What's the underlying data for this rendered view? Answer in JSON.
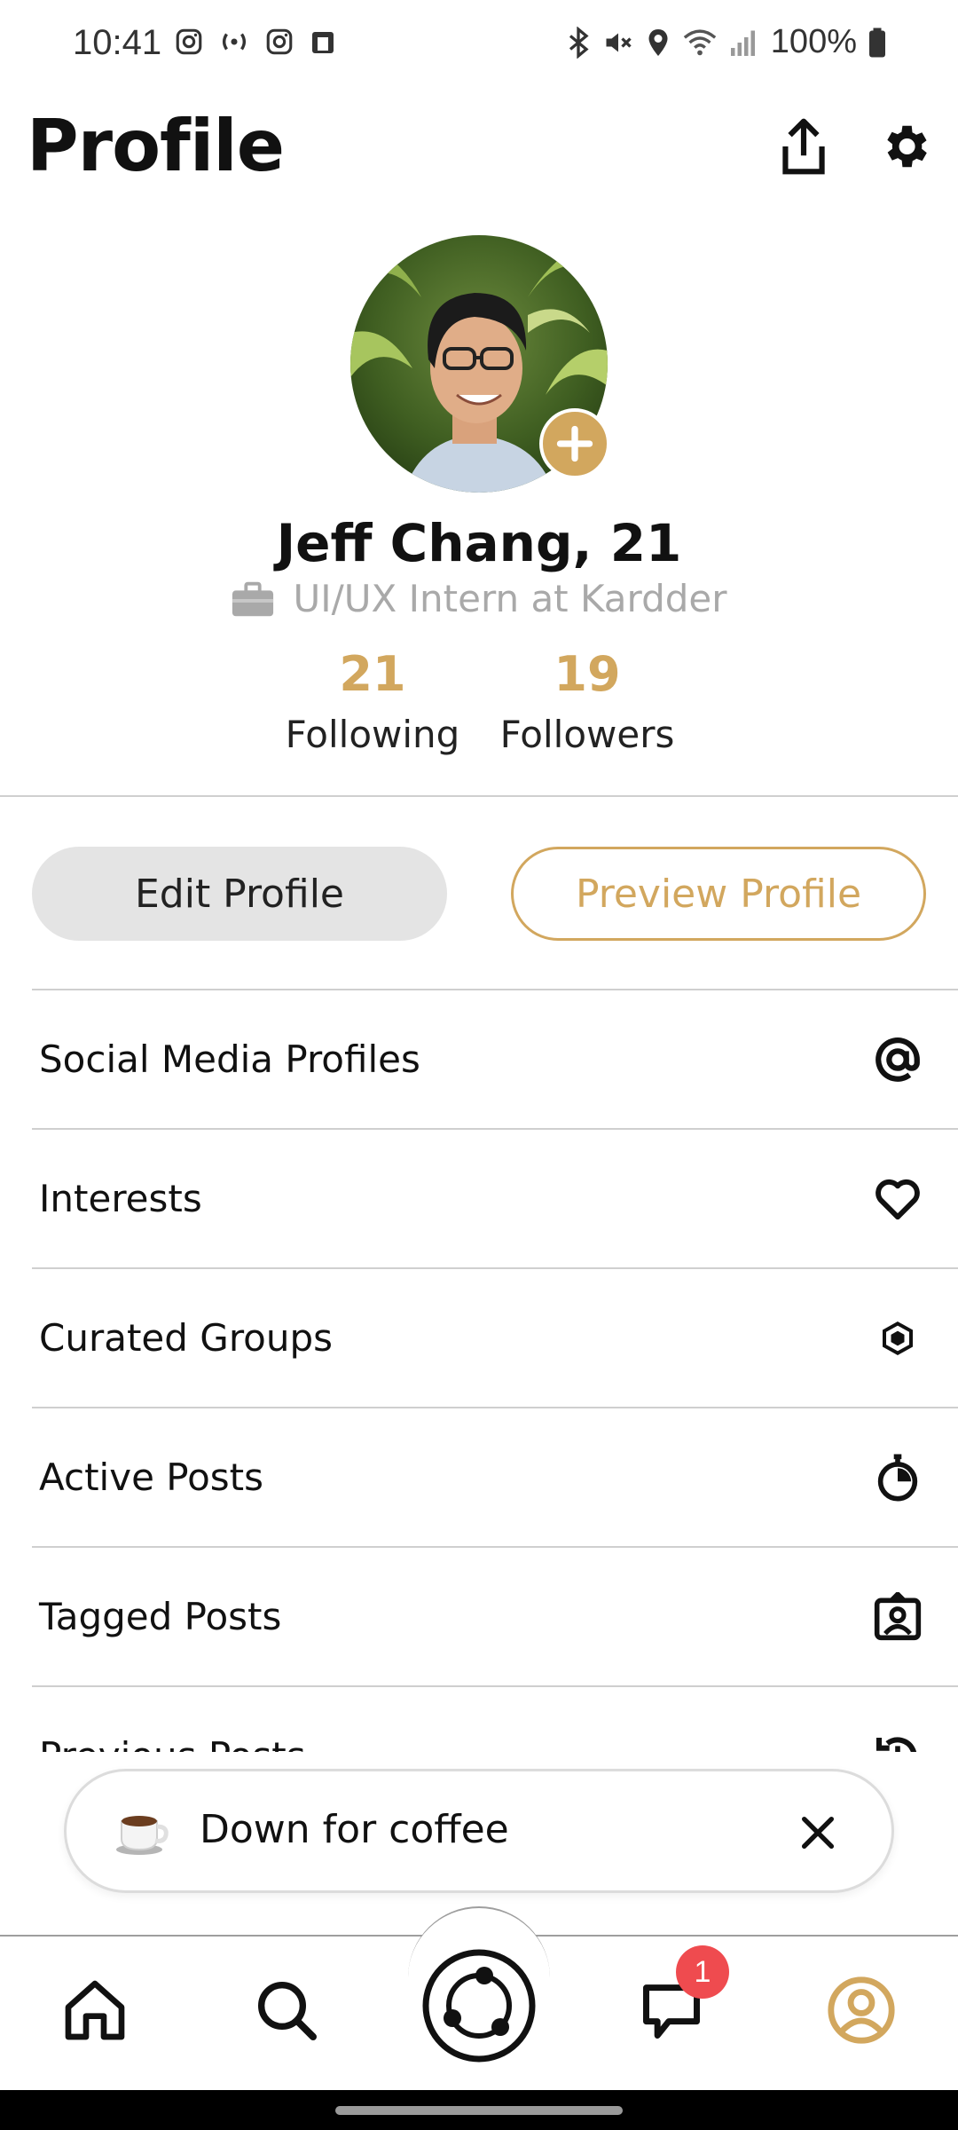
{
  "status_bar": {
    "time": "10:41",
    "battery": "100%",
    "left_icons": [
      "instagram-icon",
      "broadcast-icon",
      "instagram-icon",
      "cast-icon"
    ],
    "right_icons": [
      "bluetooth-icon",
      "mute-icon",
      "location-icon",
      "wifi-icon",
      "signal-icon",
      "battery-icon"
    ]
  },
  "header": {
    "title": "Profile",
    "share_icon": "share-icon",
    "settings_icon": "gear-icon"
  },
  "profile": {
    "name": "Jeff Chang, 21",
    "job": "UI/UX Intern at Kardder",
    "following_count": "21",
    "following_label": "Following",
    "followers_count": "19",
    "followers_label": "Followers"
  },
  "actions": {
    "edit": "Edit Profile",
    "preview": "Preview Profile"
  },
  "menu": [
    {
      "label": "Social Media Profiles",
      "icon": "at-sign-icon"
    },
    {
      "label": "Interests",
      "icon": "heart-icon"
    },
    {
      "label": "Curated Groups",
      "icon": "hexagon-icon"
    },
    {
      "label": "Active Posts",
      "icon": "stopwatch-icon"
    },
    {
      "label": "Tagged Posts",
      "icon": "tag-person-icon"
    },
    {
      "label": "Previous Posts",
      "icon": "history-icon"
    }
  ],
  "status_pill": {
    "emoji": "coffee-icon",
    "text": "Down for coffee"
  },
  "nav": {
    "items": [
      "home-icon",
      "search-icon",
      "kardder-logo-icon",
      "chat-icon",
      "profile-icon"
    ],
    "chat_badge": "1"
  },
  "colors": {
    "accent": "#d2a75e",
    "badge": "#ef4b4f",
    "pill_gray": "#e4e4e4"
  }
}
